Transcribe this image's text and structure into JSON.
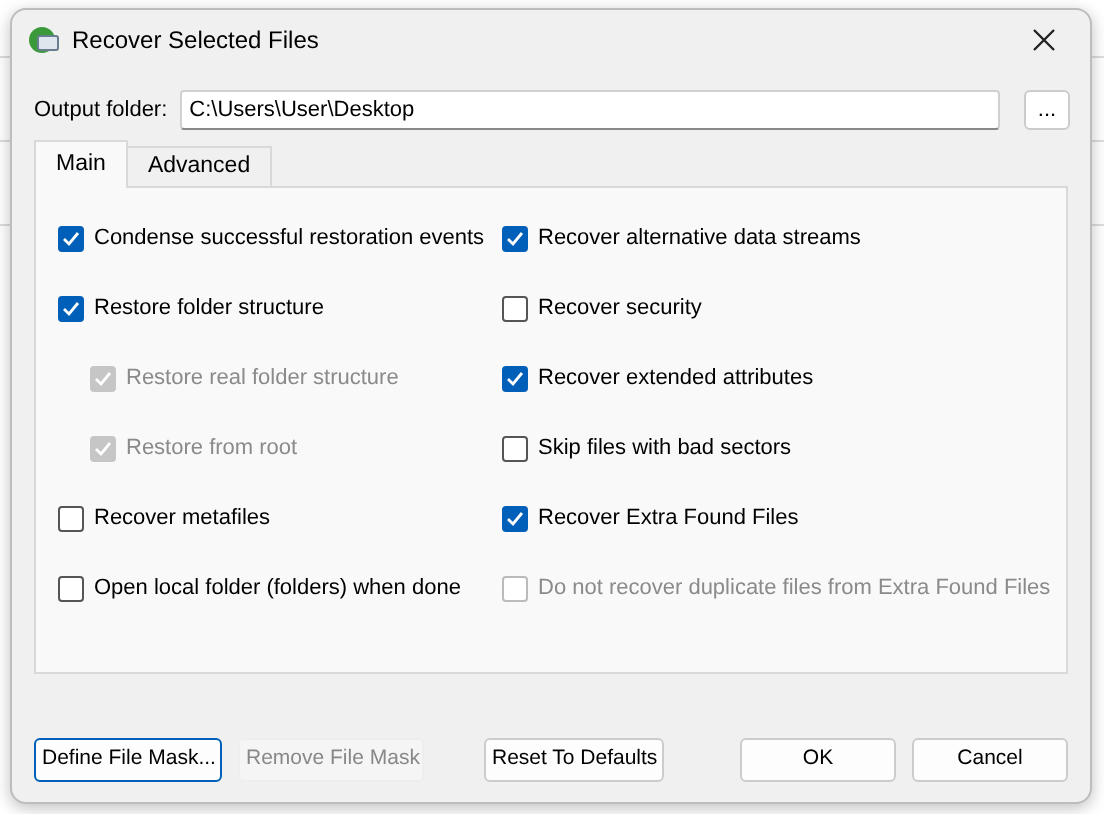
{
  "window": {
    "title": "Recover Selected Files"
  },
  "output_folder": {
    "label": "Output folder:",
    "value": "C:\\Users\\User\\Desktop",
    "browse_button": "..."
  },
  "tabs": [
    {
      "label": "Main",
      "selected": true
    },
    {
      "label": "Advanced",
      "selected": false
    }
  ],
  "left_options": [
    {
      "label": "Condense successful restoration events",
      "checked": true,
      "disabled": false
    },
    {
      "label": "Restore folder structure",
      "checked": true,
      "disabled": false,
      "children": [
        {
          "label": "Restore real folder structure",
          "checked": true,
          "disabled": true
        },
        {
          "label": "Restore from root",
          "checked": true,
          "disabled": true
        }
      ]
    },
    {
      "label": "Recover metafiles",
      "checked": false,
      "disabled": false
    },
    {
      "label": "Open local folder (folders) when done",
      "checked": false,
      "disabled": false
    }
  ],
  "right_options": [
    {
      "label": "Recover alternative data streams",
      "checked": true,
      "disabled": false
    },
    {
      "label": "Recover security",
      "checked": false,
      "disabled": false
    },
    {
      "label": "Recover extended attributes",
      "checked": true,
      "disabled": false
    },
    {
      "label": "Skip files with bad sectors",
      "checked": false,
      "disabled": false
    },
    {
      "label": "Recover Extra Found Files",
      "checked": true,
      "disabled": false
    },
    {
      "label": "Do not recover duplicate files from Extra Found Files",
      "checked": false,
      "disabled": true
    }
  ],
  "buttons": [
    {
      "label": "Define File Mask...",
      "kind": "focused",
      "disabled": false
    },
    {
      "label": "Remove File Mask",
      "kind": "normal",
      "disabled": true
    },
    {
      "label": "Reset To Defaults",
      "kind": "normal",
      "disabled": false
    },
    {
      "label": "OK",
      "kind": "normal",
      "disabled": false
    },
    {
      "label": "Cancel",
      "kind": "normal",
      "disabled": false
    }
  ]
}
